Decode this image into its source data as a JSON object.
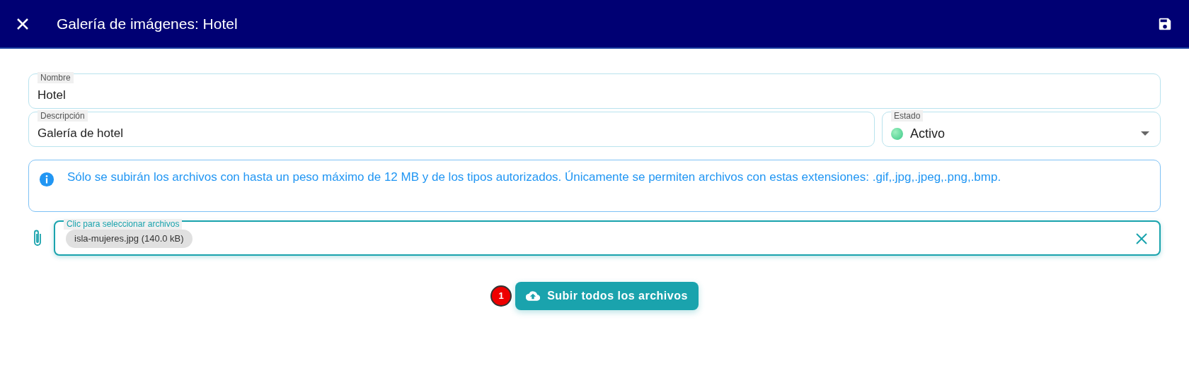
{
  "header": {
    "title": "Galería de imágenes: Hotel"
  },
  "fields": {
    "nombre": {
      "label": "Nombre",
      "value": "Hotel"
    },
    "descripcion": {
      "label": "Descripción",
      "value": "Galería de hotel"
    },
    "estado": {
      "label": "Estado",
      "value": "Activo"
    }
  },
  "info": "Sólo se subirán los archivos con hasta un peso máximo de 12 MB y de los tipos autorizados. Únicamente se permiten archivos con estas extensiones: .gif,.jpg,.jpeg,.png,.bmp.",
  "file_input": {
    "label": "Clic para seleccionar archivos",
    "files": [
      "isla-mujeres.jpg (140.0 kB)"
    ]
  },
  "upload": {
    "badge": "1",
    "label": "Subir todos los archivos"
  }
}
